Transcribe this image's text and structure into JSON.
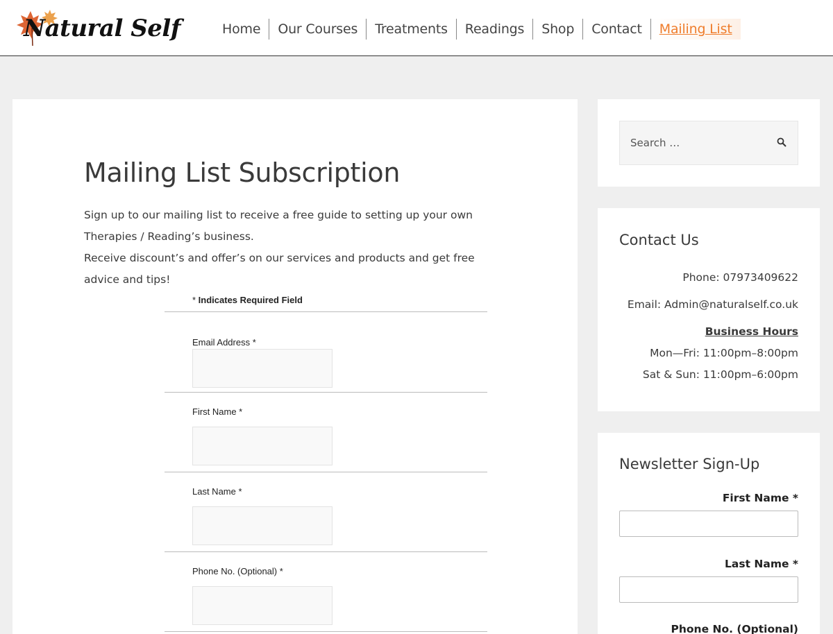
{
  "header": {
    "logo_text": "Natural Self",
    "nav": [
      {
        "label": "Home"
      },
      {
        "label": "Our Courses"
      },
      {
        "label": "Treatments"
      },
      {
        "label": "Readings"
      },
      {
        "label": "Shop"
      },
      {
        "label": "Contact"
      },
      {
        "label": "Mailing List",
        "active": true
      }
    ]
  },
  "main": {
    "title": "Mailing List Subscription",
    "intro_line1": "Sign up to our mailing list to receive a free guide to setting up your own Therapies / Reading’s business.",
    "intro_line2": "Receive discount’s and offer’s on our services and products and get free advice and tips!",
    "form": {
      "required_prefix": "* ",
      "required_note": "Indicates Required Field",
      "fields": [
        {
          "label": "Email Address *",
          "value": ""
        },
        {
          "label": "First Name *",
          "value": ""
        },
        {
          "label": "Last Name *",
          "value": ""
        },
        {
          "label": "Phone No. (Optional) *",
          "value": ""
        }
      ]
    }
  },
  "sidebar": {
    "search": {
      "placeholder": "Search …"
    },
    "contact": {
      "title": "Contact Us",
      "phone": "Phone: 07973409622",
      "email": "Email: Admin@naturalself.co.uk",
      "hours_title": "Business Hours",
      "weekday": "Mon—Fri: 11:00pm–8:00pm",
      "weekend": "Sat & Sun: 11:00pm–6:00pm"
    },
    "newsletter": {
      "title": "Newsletter Sign-Up",
      "first_name_label": "First Name *",
      "last_name_label": "Last Name *",
      "phone_label": "Phone No. (Optional)"
    }
  },
  "colors": {
    "accent": "#ef7d2c",
    "background": "#efefef",
    "text": "#3a3a3a"
  }
}
